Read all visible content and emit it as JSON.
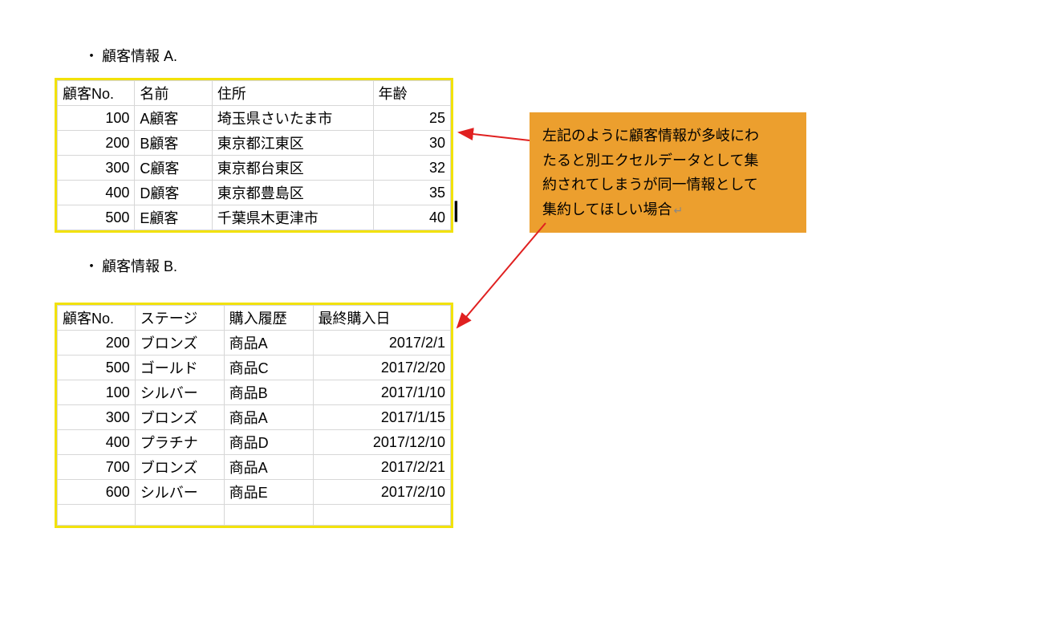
{
  "captionA": "顧客情報 A.",
  "captionB": "顧客情報 B.",
  "bullet": "・",
  "tableA": {
    "headers": [
      "顧客No.",
      "名前",
      "住所",
      "年齢"
    ],
    "rows": [
      {
        "no": "100",
        "name": "A顧客",
        "addr": "埼玉県さいたま市",
        "age": "25"
      },
      {
        "no": "200",
        "name": "B顧客",
        "addr": "東京都江東区",
        "age": "30"
      },
      {
        "no": "300",
        "name": "C顧客",
        "addr": "東京都台東区",
        "age": "32"
      },
      {
        "no": "400",
        "name": "D顧客",
        "addr": "東京都豊島区",
        "age": "35"
      },
      {
        "no": "500",
        "name": "E顧客",
        "addr": "千葉県木更津市",
        "age": "40"
      }
    ]
  },
  "tableB": {
    "headers": [
      "顧客No.",
      "ステージ",
      "購入履歴",
      "最終購入日"
    ],
    "rows": [
      {
        "no": "200",
        "stage": "ブロンズ",
        "hist": "商品A",
        "date": "2017/2/1"
      },
      {
        "no": "500",
        "stage": "ゴールド",
        "hist": "商品C",
        "date": "2017/2/20"
      },
      {
        "no": "100",
        "stage": "シルバー",
        "hist": "商品B",
        "date": "2017/1/10"
      },
      {
        "no": "300",
        "stage": "ブロンズ",
        "hist": "商品A",
        "date": "2017/1/15"
      },
      {
        "no": "400",
        "stage": "プラチナ",
        "hist": "商品D",
        "date": "2017/12/10"
      },
      {
        "no": "700",
        "stage": "ブロンズ",
        "hist": "商品A",
        "date": "2017/2/21"
      },
      {
        "no": "600",
        "stage": "シルバー",
        "hist": "商品E",
        "date": "2017/2/10"
      }
    ]
  },
  "callout": {
    "line1": "左記のように顧客情報が多岐にわ",
    "line2": "たると別エクセルデータとして集",
    "line3": "約されてしまうが同一情報として",
    "line4": "集約してほしい場合"
  },
  "returnMark": "↵"
}
